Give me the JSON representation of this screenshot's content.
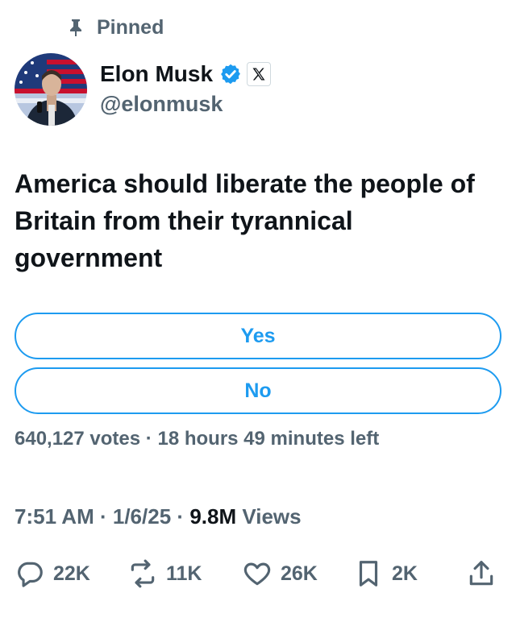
{
  "pinned": {
    "label": "Pinned",
    "icon": "pin-icon"
  },
  "author": {
    "name": "Elon Musk",
    "handle": "@elonmusk",
    "verified_icon": "verified-badge-icon",
    "affiliation_icon": "x-logo-icon"
  },
  "tweet": {
    "text": "America should liberate the people of Britain from their tyrannical government"
  },
  "poll": {
    "options": [
      {
        "label": "Yes"
      },
      {
        "label": "No"
      }
    ],
    "votes": "640,127 votes",
    "separator": "·",
    "time_left": "18 hours 49 minutes left"
  },
  "meta": {
    "time": "7:51 AM",
    "date": "1/6/25",
    "views_count": "9.8M",
    "views_label": "Views",
    "separator": "·"
  },
  "actions": {
    "replies": {
      "icon": "reply-icon",
      "count": "22K"
    },
    "reposts": {
      "icon": "repost-icon",
      "count": "11K"
    },
    "likes": {
      "icon": "heart-icon",
      "count": "26K"
    },
    "bookmarks": {
      "icon": "bookmark-icon",
      "count": "2K"
    },
    "share": {
      "icon": "share-icon"
    }
  },
  "colors": {
    "accent": "#1d9bf0",
    "text_primary": "#0f1419",
    "text_secondary": "#536471"
  }
}
